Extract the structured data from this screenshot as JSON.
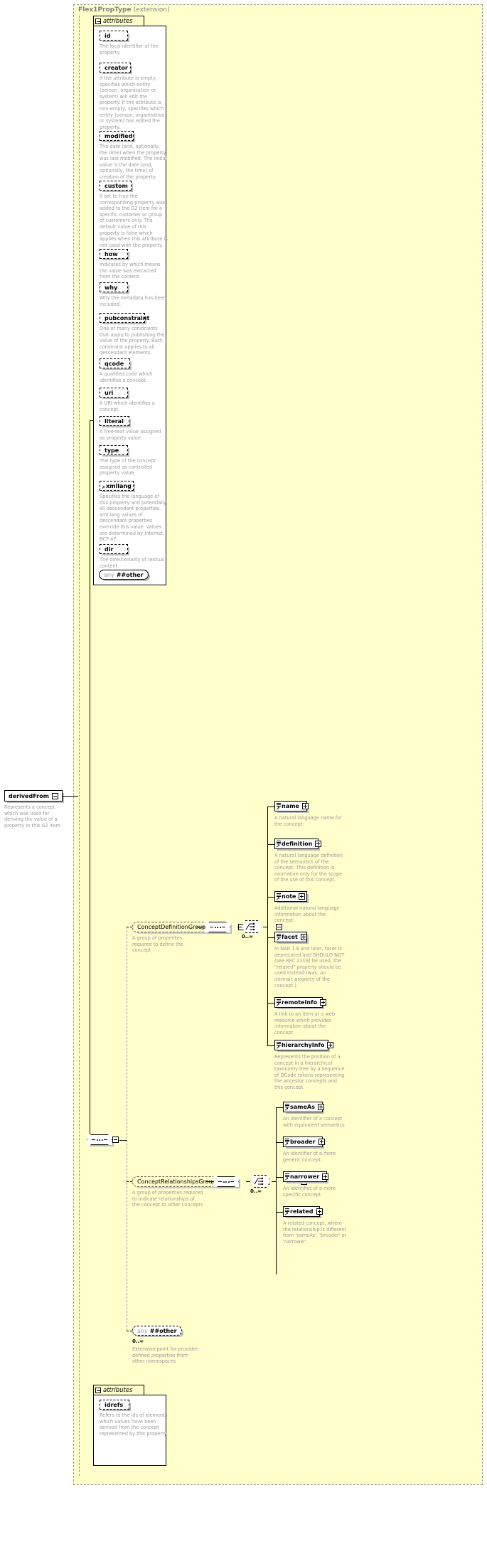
{
  "diagram": {
    "type": "xsd-schema-documentation",
    "extension_panel": {
      "title": "Flex1PropType",
      "subtitle": "(extension)"
    },
    "root_element": {
      "name": "derivedFrom",
      "description": "Represents a concept which was used for deriving the value of a property in this G2 item",
      "toggle": "minus"
    },
    "attributes_section_1": {
      "label": "attributes",
      "toggle": "minus",
      "items": [
        {
          "name": "id",
          "description": "The local identifier of the property."
        },
        {
          "name": "creator",
          "description": "If the attribute is empty, specifies which entity (person, organisation or system) will edit the property. If the attribute is non-empty, specifies which entity (person, organisation or system) has edited the property."
        },
        {
          "name": "modified",
          "description": "The date (and, optionally, the time) when the property was last modified. The initial value is the date (and, optionally, the time) of creation of the property."
        },
        {
          "name": "custom",
          "description": "If set to true the corresponding property was added to the G2 Item for a specific customer or group of customers only. The default value of this property is false which applies when this attribute is not used with the property."
        },
        {
          "name": "how",
          "description": "Indicates by which means the value was extracted from the content."
        },
        {
          "name": "why",
          "description": "Why the metadata has been included."
        },
        {
          "name": "pubconstraint",
          "description": "One or many constraints that apply to publishing the value of the property. Each constraint applies to all descendant elements."
        },
        {
          "name": "qcode",
          "description": "A qualified code which identifies a concept."
        },
        {
          "name": "uri",
          "description": "A URI which identifies a concept."
        },
        {
          "name": "literal",
          "description": "A free-text value assigned as property value."
        },
        {
          "name": "type",
          "description": "The type of the concept assigned as controlled property value."
        },
        {
          "name": "xmllang",
          "description": "Specifies the language of this property and potentially all descendant properties. xml:lang values of descendant properties override this value. Values are determined by Internet BCP 47."
        },
        {
          "name": "dir",
          "description": "The directionality of textual content."
        }
      ],
      "wildcard": {
        "prefix": "any",
        "namespace": "##other"
      }
    },
    "attributes_section_2": {
      "label": "attributes",
      "toggle": "minus",
      "items": [
        {
          "name": "idrefs",
          "description": "Refers to the ids of elements which values have been derived from the concept represented by this property"
        }
      ]
    },
    "content_model": {
      "compositor": "sequence",
      "branches": [
        {
          "group": "ConceptDefinitionGroup",
          "group_description": "A group of properites required to define the concept",
          "compositor": "sequence",
          "choice_occurs": "0..∞",
          "elements": [
            {
              "name": "name",
              "description": "A natural language name for the concept.",
              "toggle": "plus"
            },
            {
              "name": "definition",
              "description": "A natural language definition of the semantics of the concept. This definition is normative only for the scope of the use of this concept.",
              "toggle": "plus"
            },
            {
              "name": "note",
              "description": "Additional natural language information about the concept.",
              "toggle": "plus"
            },
            {
              "name": "facet",
              "description": "In NAR 1.8 and later, facet is deprecated and SHOULD NOT (see RFC 2119) be used, the \"related\" property should be used instead (was: An intrinsic property of the concept.)",
              "toggle": "plus"
            },
            {
              "name": "remoteInfo",
              "description": "A link to an item or a web resource which provides information about the concept",
              "toggle": "plus"
            },
            {
              "name": "hierarchyInfo",
              "description": "Represents the position of a concept in a hierarchical taxonomy tree by a sequence of QCode tokens representing the ancestor concepts and this concept",
              "toggle": "plus"
            }
          ]
        },
        {
          "group": "ConceptRelationshipsGroup",
          "group_description": "A group of properties required to indicate relationships of the concept to other concepts",
          "compositor": "sequence",
          "choice_occurs": "0..∞",
          "elements": [
            {
              "name": "sameAs",
              "description": "An identifier of a concept with equivalent semantics",
              "toggle": "plus"
            },
            {
              "name": "broader",
              "description": "An identifier of a more generic concept.",
              "toggle": "plus"
            },
            {
              "name": "narrower",
              "description": "An identifier of a more specific concept.",
              "toggle": "plus"
            },
            {
              "name": "related",
              "description": "A related concept, where the relationship is different from 'sameAs', 'broader' or 'narrower'.",
              "toggle": "plus"
            }
          ]
        },
        {
          "wildcard": {
            "prefix": "any",
            "namespace": "##other"
          },
          "occurs": "0..∞",
          "description": "Extension point for provider-defined properties from other namespaces"
        }
      ]
    },
    "colors": {
      "panel_background": "#ffffcc",
      "node_background": "#ffffff",
      "description_text": "#999999",
      "border": "#000000",
      "shadow": "#bbbbbb"
    }
  }
}
